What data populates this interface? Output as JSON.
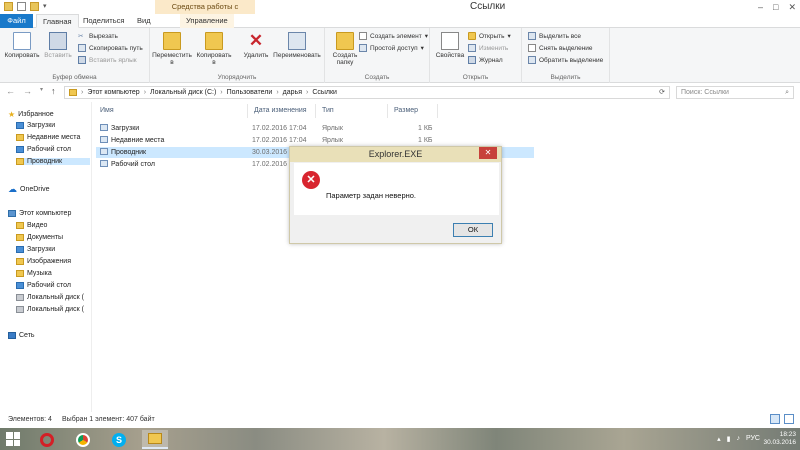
{
  "window": {
    "title": "Ссылки",
    "context_tab_header": "Средства работы с ярлыками",
    "minimize": "–",
    "maximize": "□",
    "close": "✕"
  },
  "ribbon_tabs": {
    "file": "Файл",
    "home": "Главная",
    "share": "Поделиться",
    "view": "Вид",
    "manage": "Управление"
  },
  "ribbon": {
    "clipboard": {
      "label": "Буфер обмена",
      "copy": "Копировать",
      "paste": "Вставить",
      "cut": "Вырезать",
      "copy_path": "Скопировать путь",
      "paste_shortcut": "Вставить ярлык"
    },
    "organize": {
      "label": "Упорядочить",
      "move_to": "Переместить в",
      "copy_to": "Копировать в",
      "delete": "Удалить",
      "rename": "Переименовать"
    },
    "create": {
      "label": "Создать",
      "new_folder": "Создать папку",
      "new_item": "Создать элемент",
      "easy_access": "Простой доступ"
    },
    "open": {
      "label": "Открыть",
      "properties": "Свойства",
      "open": "Открыть",
      "edit": "Изменить",
      "history": "Журнал"
    },
    "select": {
      "label": "Выделить",
      "select_all": "Выделить все",
      "select_none": "Снять выделение",
      "invert": "Обратить выделение"
    }
  },
  "address": {
    "segments": [
      "Этот компьютер",
      "Локальный диск (C:)",
      "Пользователи",
      "дарья",
      "Ссылки"
    ],
    "search_placeholder": "Поиск: Ссылки"
  },
  "nav": {
    "favorites": "Избранное",
    "favorites_items": [
      "Загрузки",
      "Недавние места",
      "Рабочий стол",
      "Проводник"
    ],
    "onedrive": "OneDrive",
    "this_pc": "Этот компьютер",
    "pc_items": [
      "Видео",
      "Документы",
      "Загрузки",
      "Изображения",
      "Музыка",
      "Рабочий стол",
      "Локальный диск (",
      "Локальный диск ("
    ],
    "network": "Сеть"
  },
  "columns": {
    "name": "Имя",
    "date": "Дата изменения",
    "type": "Тип",
    "size": "Размер"
  },
  "files": [
    {
      "name": "Загрузки",
      "date": "17.02.2016 17:04",
      "type": "Ярлык",
      "size": "1 КБ"
    },
    {
      "name": "Недавние места",
      "date": "17.02.2016 17:04",
      "type": "Ярлык",
      "size": "1 КБ"
    },
    {
      "name": "Проводник",
      "date": "30.03.2016 1",
      "type": "",
      "size": ""
    },
    {
      "name": "Рабочий стол",
      "date": "17.02.2016 1",
      "type": "",
      "size": ""
    }
  ],
  "dialog": {
    "title": "Explorer.EXE",
    "message": "Параметр задан неверно.",
    "ok": "ОК",
    "close": "✕"
  },
  "status": {
    "count": "Элементов: 4",
    "selected": "Выбран 1 элемент: 407 байт"
  },
  "taskbar": {
    "lang": "РУС",
    "time": "18:23",
    "date": "30.03.2016"
  }
}
